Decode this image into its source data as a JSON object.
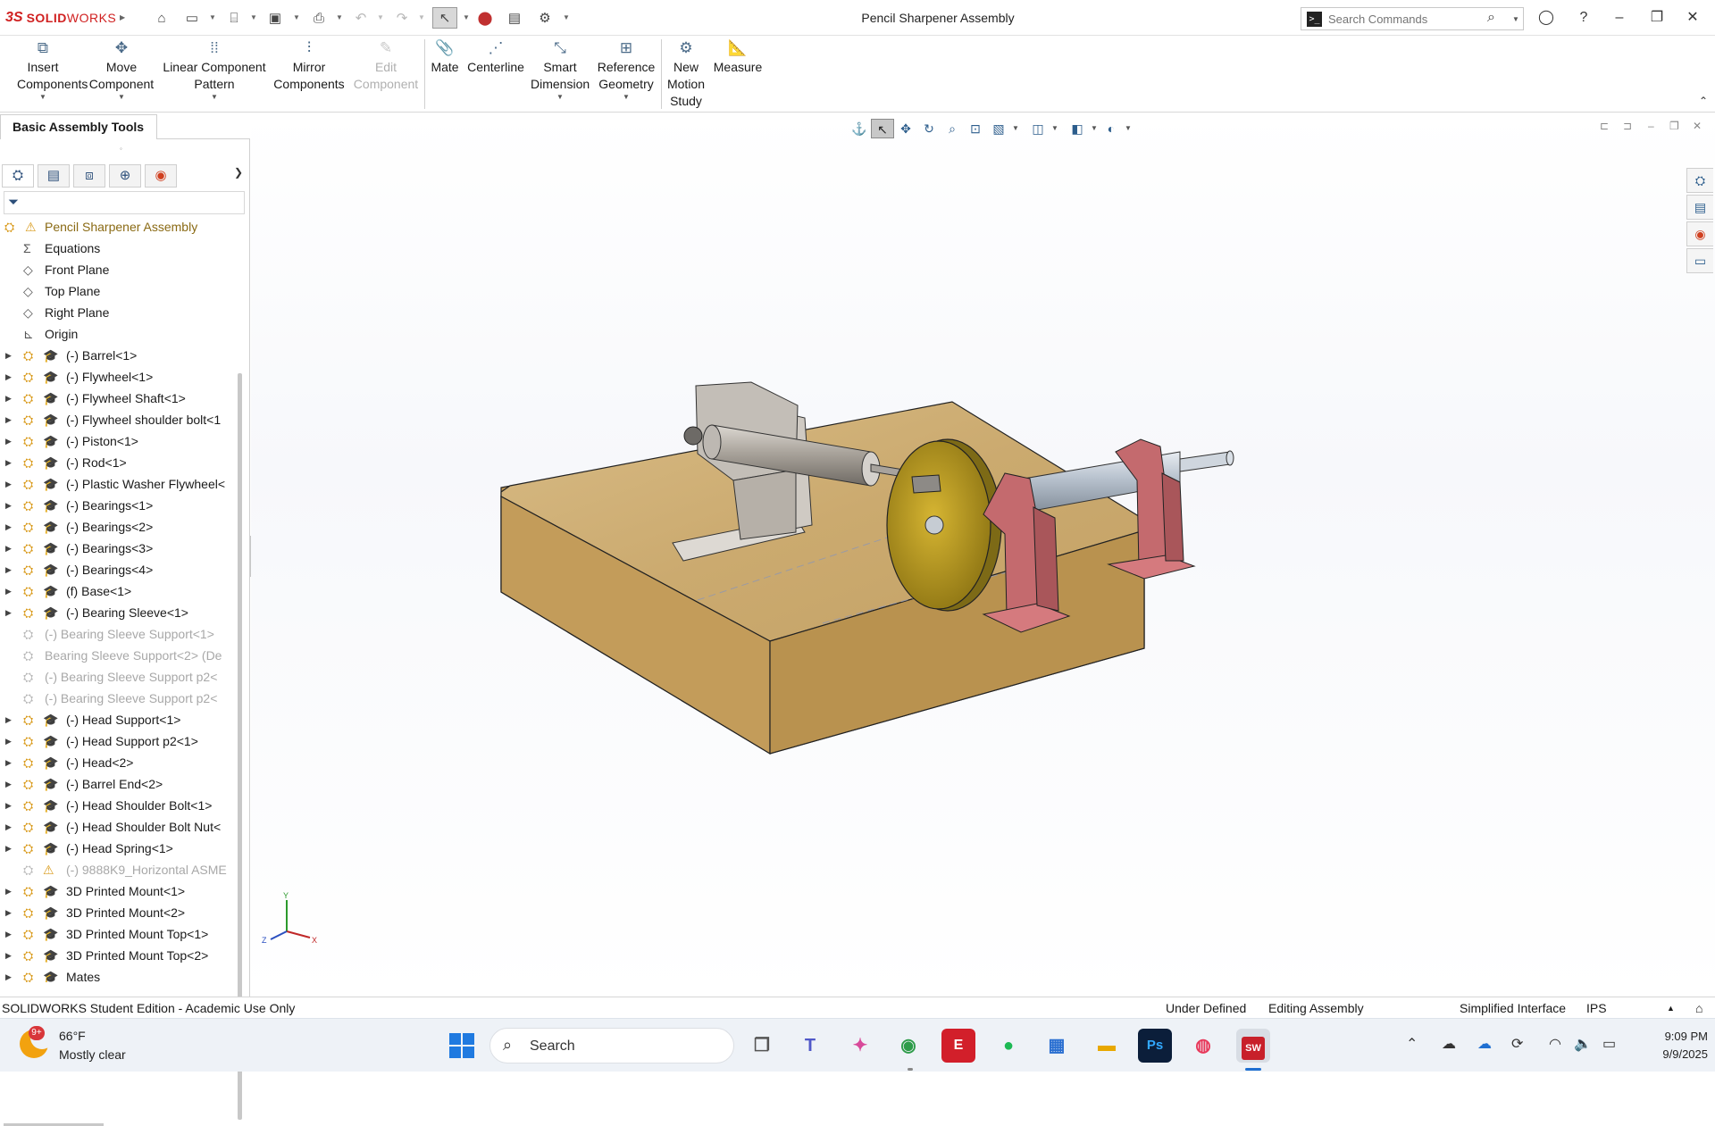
{
  "app": {
    "logo_mark": "3S",
    "logo_word_bold": "SOLID",
    "logo_word_light": "WORKS",
    "window_title": "Pencil Sharpener Assembly"
  },
  "search": {
    "placeholder": "Search Commands",
    "value": ""
  },
  "command_manager": {
    "insert_components": "Insert Components",
    "move_component": "Move Component",
    "linear_component_pattern": "Linear Component Pattern",
    "mirror_components": "Mirror Components",
    "edit_component": "Edit Component",
    "mate": "Mate",
    "centerline": "Centerline",
    "smart_dimension": "Smart Dimension",
    "reference_geometry": "Reference Geometry",
    "new_motion_study": "New Motion Study",
    "measure": "Measure"
  },
  "panel_tab": "Basic Assembly Tools",
  "tree": {
    "root": "Pencil Sharpener Assembly",
    "items": [
      {
        "label": "Equations",
        "type": "plain",
        "icon": "equations-icon"
      },
      {
        "label": "Front Plane",
        "type": "plain",
        "icon": "plane-icon"
      },
      {
        "label": "Top Plane",
        "type": "plain",
        "icon": "plane-icon"
      },
      {
        "label": "Right Plane",
        "type": "plain",
        "icon": "plane-icon"
      },
      {
        "label": "Origin",
        "type": "plain",
        "icon": "origin-icon"
      },
      {
        "label": "(-) Barrel<1>",
        "type": "part"
      },
      {
        "label": "(-) Flywheel<1>",
        "type": "part"
      },
      {
        "label": "(-) Flywheel Shaft<1>",
        "type": "part"
      },
      {
        "label": "(-) Flywheel shoulder bolt<1",
        "type": "part"
      },
      {
        "label": "(-) Piston<1>",
        "type": "part"
      },
      {
        "label": "(-) Rod<1>",
        "type": "part"
      },
      {
        "label": "(-) Plastic Washer Flywheel<",
        "type": "part"
      },
      {
        "label": "(-) Bearings<1>",
        "type": "part"
      },
      {
        "label": "(-) Bearings<2>",
        "type": "part"
      },
      {
        "label": "(-) Bearings<3>",
        "type": "part"
      },
      {
        "label": "(-) Bearings<4>",
        "type": "part"
      },
      {
        "label": "(f) Base<1>",
        "type": "part"
      },
      {
        "label": "(-) Bearing Sleeve<1>",
        "type": "part"
      },
      {
        "label": "(-) Bearing Sleeve Support<1>",
        "type": "ghost"
      },
      {
        "label": "Bearing Sleeve Support<2> (De",
        "type": "ghost"
      },
      {
        "label": "(-) Bearing Sleeve Support p2<",
        "type": "ghost"
      },
      {
        "label": "(-) Bearing Sleeve Support p2<",
        "type": "ghost"
      },
      {
        "label": "(-) Head Support<1>",
        "type": "part"
      },
      {
        "label": "(-) Head Support p2<1>",
        "type": "part"
      },
      {
        "label": "(-) Head<2>",
        "type": "part"
      },
      {
        "label": "(-) Barrel End<2>",
        "type": "part"
      },
      {
        "label": "(-) Head Shoulder Bolt<1>",
        "type": "part"
      },
      {
        "label": "(-) Head Shoulder Bolt Nut<",
        "type": "part"
      },
      {
        "label": "(-) Head Spring<1>",
        "type": "part"
      },
      {
        "label": "(-) 9888K9_Horizontal ASME",
        "type": "warn"
      },
      {
        "label": "3D Printed Mount<1>",
        "type": "part"
      },
      {
        "label": "3D Printed Mount<2>",
        "type": "part"
      },
      {
        "label": "3D Printed Mount Top<1>",
        "type": "part"
      },
      {
        "label": "3D Printed Mount Top<2>",
        "type": "part"
      },
      {
        "label": "Mates",
        "type": "part"
      }
    ]
  },
  "triad": {
    "x": "X",
    "y": "Y",
    "z": "Z"
  },
  "status": {
    "edition": "SOLIDWORKS Student Edition - Academic Use Only",
    "definition": "Under Defined",
    "mode": "Editing Assembly",
    "interface": "Simplified Interface",
    "units": "IPS"
  },
  "taskbar": {
    "weather_badge": "9+",
    "temperature": "66°F",
    "weather_desc": "Mostly clear",
    "search_label": "Search",
    "time": "9:09 PM",
    "date": "9/9/2025",
    "photoshop_label": "Ps",
    "solidworks_label": "SW"
  },
  "colors": {
    "accent": "#d02020",
    "wood": "#c9a66b",
    "flywheel": "#b89a22",
    "bearing_support": "#c46a6e",
    "shaft": "#aeb8c4"
  }
}
